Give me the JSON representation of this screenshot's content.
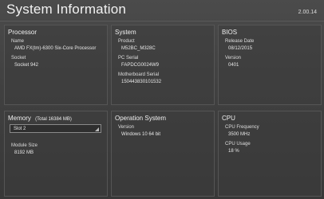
{
  "window": {
    "title": "System Information",
    "version": "2.00.14"
  },
  "processor": {
    "title": "Processor",
    "name_label": "Name",
    "name_value": "AMD FX(tm)-6300 Six-Core Processor",
    "socket_label": "Socket",
    "socket_value": "Socket 942"
  },
  "system": {
    "title": "System",
    "product_label": "Product",
    "product_value": "M52BC_M328C",
    "pc_serial_label": "PC Serial",
    "pc_serial_value": "FAPDCG0024W9",
    "mb_serial_label": "Motherboard Serial",
    "mb_serial_value": "150443830101532"
  },
  "bios": {
    "title": "BIOS",
    "release_label": "Release Date",
    "release_value": "08/12/2015",
    "version_label": "Version",
    "version_value": "0401"
  },
  "memory": {
    "title": "Memory",
    "total": "(Total 16384 MB)",
    "slot_selected": "Slot 2",
    "module_label": "Module Size",
    "module_value": "8192 MB"
  },
  "os": {
    "title": "Operation System",
    "version_label": "Version",
    "version_value": "Windows 10 64 bit"
  },
  "cpu": {
    "title": "CPU",
    "freq_label": "CPU Frequency",
    "freq_value": "3500 MHz",
    "usage_label": "CPU Usage",
    "usage_value": "18 %"
  }
}
